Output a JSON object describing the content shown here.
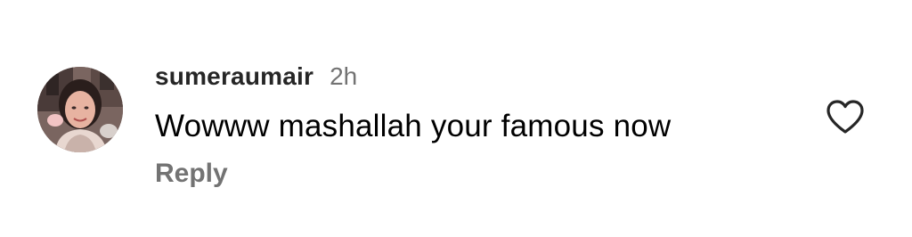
{
  "comment": {
    "avatar_icon": "user-profile-photo",
    "username": "sumeraumair",
    "timestamp": "2h",
    "text": "Wowww mashallah your famous now",
    "reply_label": "Reply",
    "like_icon": "heart-outline-icon"
  },
  "colors": {
    "username": "#262626",
    "secondary_text": "#737373",
    "body_text": "#000000",
    "icon_stroke": "#262626",
    "background": "#ffffff"
  }
}
